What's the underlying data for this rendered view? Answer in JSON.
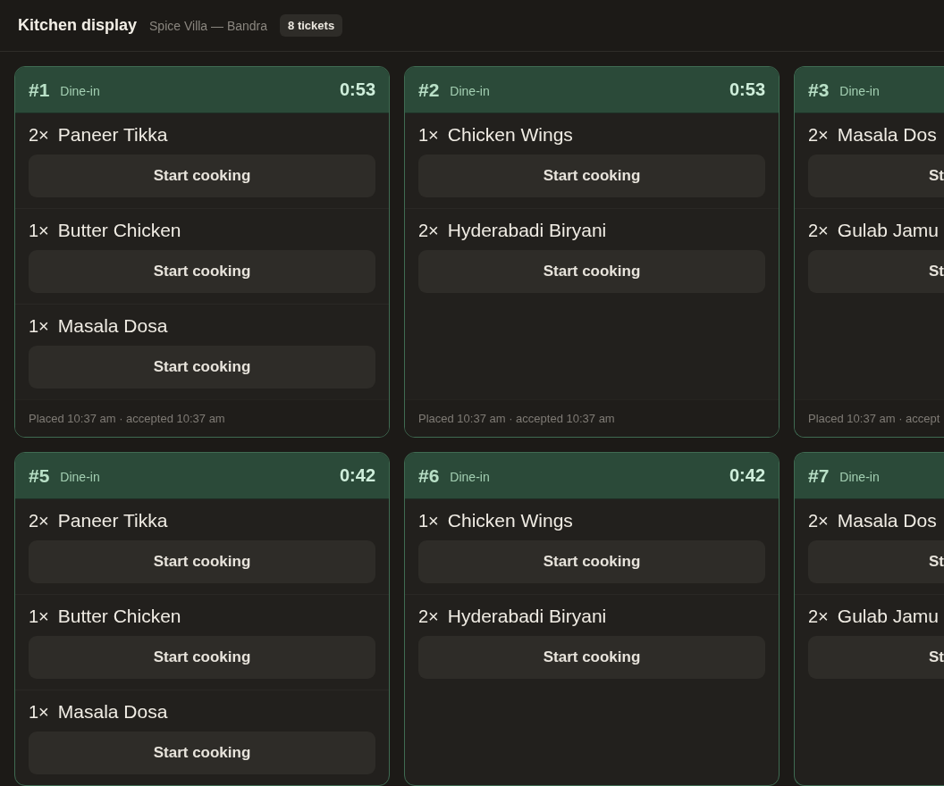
{
  "header": {
    "title": "Kitchen display",
    "location": "Spice Villa — Bandra",
    "count_badge": "8 tickets"
  },
  "tickets": [
    {
      "number": "#1",
      "type": "Dine-in",
      "timer": "0:53",
      "clipped": false,
      "items": [
        {
          "qty": "2×",
          "name": "Paneer Tikka",
          "action": "Start cooking"
        },
        {
          "qty": "1×",
          "name": "Butter Chicken",
          "action": "Start cooking"
        },
        {
          "qty": "1×",
          "name": "Masala Dosa",
          "action": "Start cooking"
        }
      ],
      "footer": "Placed 10:37 am · accepted 10:37 am"
    },
    {
      "number": "#2",
      "type": "Dine-in",
      "timer": "0:53",
      "clipped": false,
      "items": [
        {
          "qty": "1×",
          "name": "Chicken Wings",
          "action": "Start cooking"
        },
        {
          "qty": "2×",
          "name": "Hyderabadi Biryani",
          "action": "Start cooking"
        }
      ],
      "footer": "Placed 10:37 am · accepted 10:37 am"
    },
    {
      "number": "#3",
      "type": "Dine-in",
      "clipped": true,
      "items": [
        {
          "qty": "2×",
          "name": "Masala Dos",
          "action": "St"
        },
        {
          "qty": "2×",
          "name": "Gulab Jamu",
          "action": "St"
        }
      ],
      "footer": "Placed 10:37 am · accept"
    },
    {
      "number": "#5",
      "type": "Dine-in",
      "timer": "0:42",
      "clipped": false,
      "items": [
        {
          "qty": "2×",
          "name": "Paneer Tikka",
          "action": "Start cooking"
        },
        {
          "qty": "1×",
          "name": "Butter Chicken",
          "action": "Start cooking"
        },
        {
          "qty": "1×",
          "name": "Masala Dosa",
          "action": "Start cooking"
        }
      ]
    },
    {
      "number": "#6",
      "type": "Dine-in",
      "timer": "0:42",
      "clipped": false,
      "items": [
        {
          "qty": "1×",
          "name": "Chicken Wings",
          "action": "Start cooking"
        },
        {
          "qty": "2×",
          "name": "Hyderabadi Biryani",
          "action": "Start cooking"
        }
      ]
    },
    {
      "number": "#7",
      "type": "Dine-in",
      "clipped": true,
      "items": [
        {
          "qty": "2×",
          "name": "Masala Dos",
          "action": "St"
        },
        {
          "qty": "2×",
          "name": "Gulab Jamu",
          "action": "St"
        }
      ]
    }
  ]
}
